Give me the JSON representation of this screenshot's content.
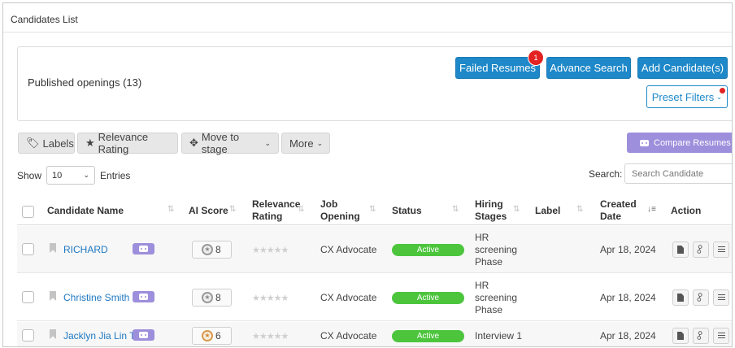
{
  "header": {
    "title": "Candidates List"
  },
  "openings": {
    "label": "Published openings (13)",
    "failed_resumes_label": "Failed Resumes",
    "failed_resumes_badge": "1",
    "advance_search_label": "Advance Search",
    "add_candidate_label": "Add Candidate(s)",
    "preset_filters_label": "Preset Filters"
  },
  "toolbar": {
    "labels_label": "Labels",
    "relevance_label": "Relevance Rating",
    "move_stage_label": "Move to stage",
    "more_label": "More",
    "compare_label": "Compare Resumes"
  },
  "table_controls": {
    "show_label": "Show",
    "entries_value": "10",
    "entries_label": "Entries",
    "search_label": "Search:",
    "search_placeholder": "Search Candidate"
  },
  "columns": {
    "name": "Candidate Name",
    "ai_score": "AI Score",
    "relevance_1": "Relevance",
    "relevance_2": "Rating",
    "job_1": "Job",
    "job_2": "Opening",
    "status": "Status",
    "hiring_1": "Hiring",
    "hiring_2": "Stages",
    "label": "Label",
    "created_1": "Created",
    "created_2": "Date",
    "action": "Action"
  },
  "rows": [
    {
      "name": "RICHARD",
      "ai_score": "8",
      "job": "CX Advocate",
      "status": "Active",
      "stage_1": "HR",
      "stage_2": "screening",
      "stage_3": "Phase",
      "created": "Apr 18, 2024"
    },
    {
      "name": "Christine Smith",
      "ai_score": "8",
      "job": "CX Advocate",
      "status": "Active",
      "stage_1": "HR",
      "stage_2": "screening",
      "stage_3": "Phase",
      "created": "Apr 18, 2024"
    },
    {
      "name": "Jacklyn Jia Lin T...",
      "ai_score": "6",
      "job": "CX Advocate",
      "status": "Active",
      "stage_1": "Interview 1",
      "created": "Apr 18, 2024"
    }
  ],
  "colors": {
    "primary": "#1e88c8",
    "purple": "#9d8fdc",
    "active": "#4cc53d",
    "badge": "#e32222"
  },
  "icons": {
    "labels": "tag-icon",
    "relevance": "star-icon",
    "move": "move-arrows-icon",
    "compare": "robot-icon",
    "ai_score": "medal-icon",
    "candidate": "bookmark-icon",
    "actions": [
      "document-icon",
      "link-icon",
      "list-icon"
    ]
  }
}
